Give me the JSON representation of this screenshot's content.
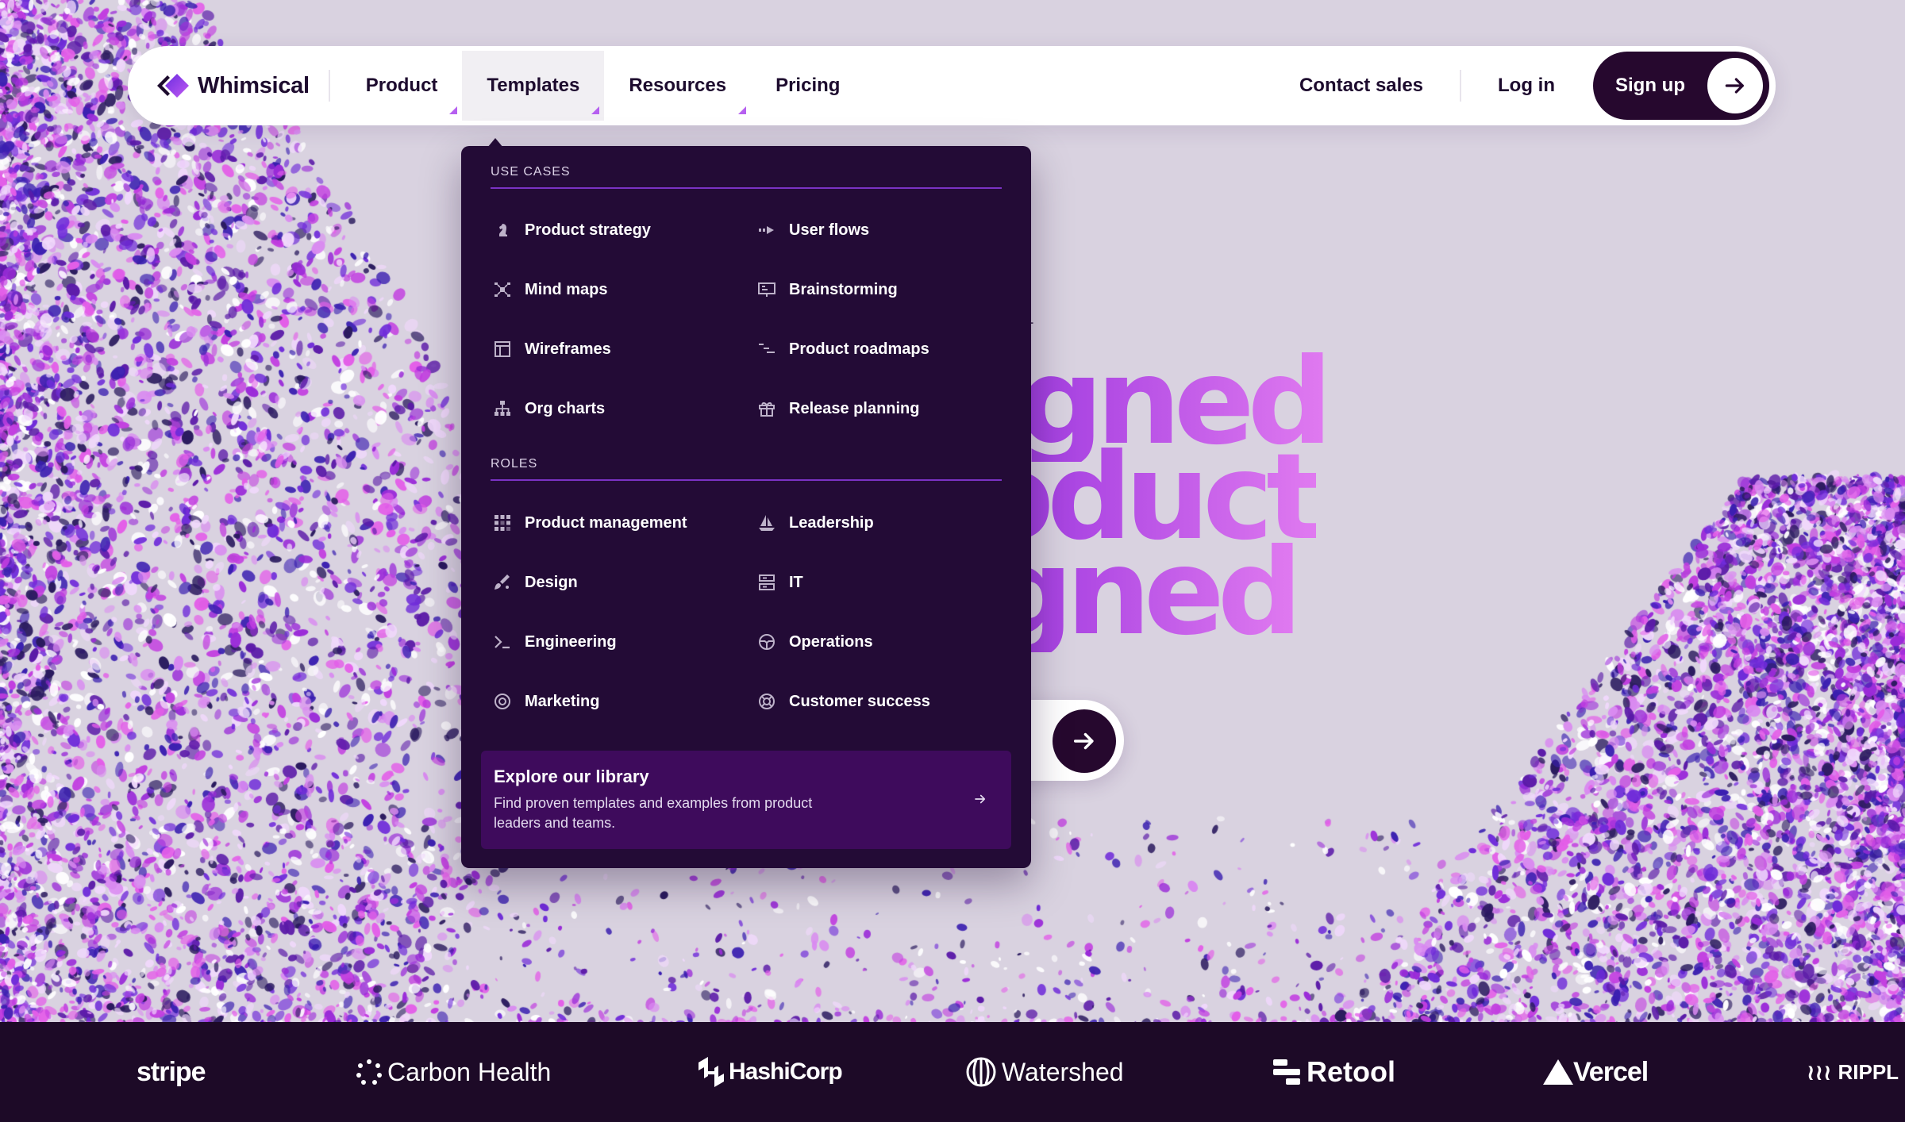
{
  "colors": {
    "background": "#d9d2e0",
    "dark": "#230b36",
    "accent": "#b660f0",
    "rule": "#7a32c4",
    "explore_bg": "#3e0b5c",
    "strip": "#1d0a27"
  },
  "nav": {
    "brand": "Whimsical",
    "items": [
      {
        "label": "Product",
        "icon": "caret-icon"
      },
      {
        "label": "Templates",
        "icon": "caret-icon",
        "active": true
      },
      {
        "label": "Resources",
        "icon": "caret-icon"
      },
      {
        "label": "Pricing"
      }
    ],
    "contact_sales": "Contact sales",
    "login": "Log in",
    "signup": "Sign up"
  },
  "hero": {
    "eyebrow_fragment": "L",
    "line1": "signed",
    "line2": "roduct",
    "line3": "ligned",
    "cta_icon": "arrow-right-icon"
  },
  "menu": {
    "use_cases_title": "USE CASES",
    "use_cases": [
      {
        "label": "Product strategy",
        "icon": "chess-knight-icon"
      },
      {
        "label": "User flows",
        "icon": "flow-arrow-icon"
      },
      {
        "label": "Mind maps",
        "icon": "mind-map-icon"
      },
      {
        "label": "Brainstorming",
        "icon": "whiteboard-icon"
      },
      {
        "label": "Wireframes",
        "icon": "wireframe-icon"
      },
      {
        "label": "Product roadmaps",
        "icon": "roadmap-icon"
      },
      {
        "label": "Org charts",
        "icon": "org-chart-icon"
      },
      {
        "label": "Release planning",
        "icon": "gift-icon"
      }
    ],
    "roles_title": "ROLES",
    "roles": [
      {
        "label": "Product management",
        "icon": "grid-dots-icon"
      },
      {
        "label": "Leadership",
        "icon": "sailboat-icon"
      },
      {
        "label": "Design",
        "icon": "paint-brush-icon"
      },
      {
        "label": "IT",
        "icon": "server-icon"
      },
      {
        "label": "Engineering",
        "icon": "terminal-icon"
      },
      {
        "label": "Operations",
        "icon": "steering-wheel-icon"
      },
      {
        "label": "Marketing",
        "icon": "target-icon"
      },
      {
        "label": "Customer success",
        "icon": "lifebuoy-icon"
      }
    ],
    "explore": {
      "title": "Explore our library",
      "description": "Find proven templates and examples from product leaders and teams.",
      "icon": "arrow-right-icon"
    }
  },
  "logos": [
    "stripe",
    "Carbon Health",
    "HashiCorp",
    "Watershed",
    "Retool",
    "Vercel",
    "RIPPL"
  ]
}
